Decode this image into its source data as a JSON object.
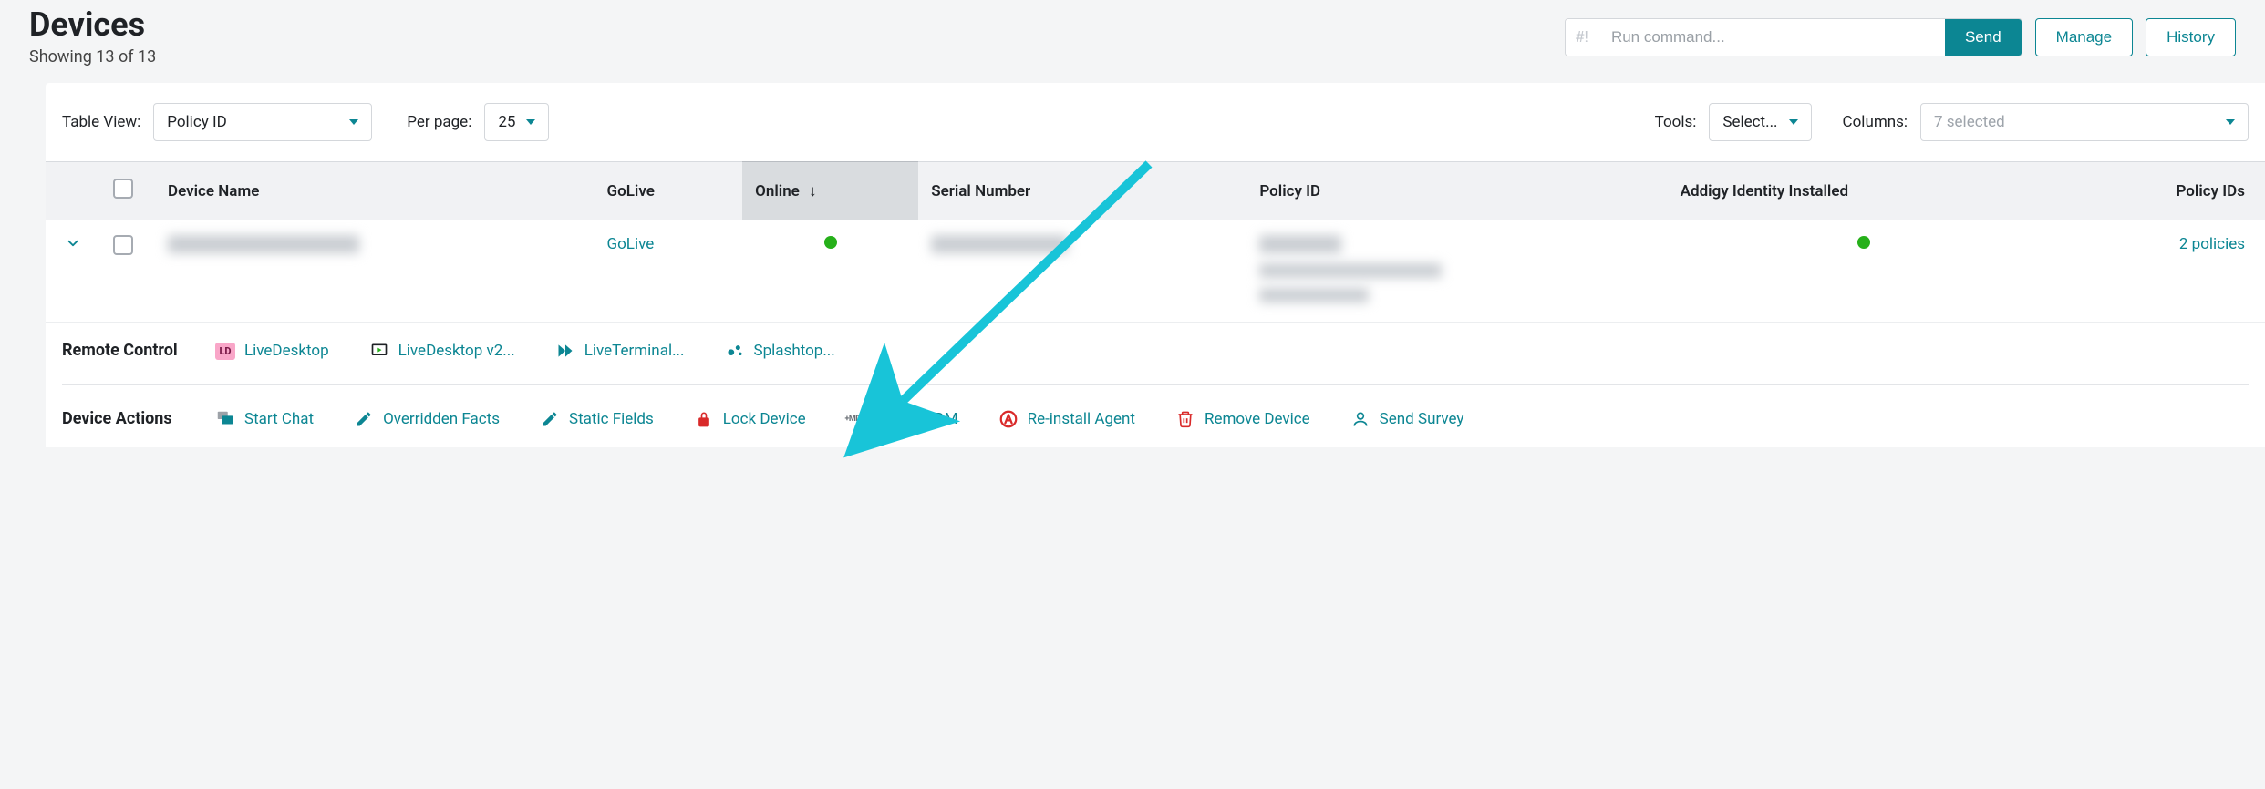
{
  "header": {
    "title": "Devices",
    "subtitle": "Showing 13 of 13",
    "command_prefix": "#!",
    "command_placeholder": "Run command...",
    "send_label": "Send",
    "manage_label": "Manage",
    "history_label": "History"
  },
  "toolbar": {
    "table_view_label": "Table View:",
    "table_view_value": "Policy ID",
    "per_page_label": "Per page:",
    "per_page_value": "25",
    "tools_label": "Tools:",
    "tools_value": "Select...",
    "columns_label": "Columns:",
    "columns_value": "7 selected"
  },
  "columns": {
    "device_name": "Device Name",
    "golive": "GoLive",
    "online": "Online",
    "serial": "Serial Number",
    "policy_id": "Policy ID",
    "addigy": "Addigy Identity Installed",
    "policy_ids": "Policy IDs"
  },
  "row": {
    "golive_link": "GoLive",
    "policies_link": "2 policies"
  },
  "remote_control": {
    "section_label": "Remote Control",
    "live_desktop": "LiveDesktop",
    "live_desktop_v2": "LiveDesktop v2...",
    "live_terminal": "LiveTerminal...",
    "splashtop": "Splashtop..."
  },
  "device_actions": {
    "section_label": "Device Actions",
    "start_chat": "Start Chat",
    "overridden_facts": "Overridden Facts",
    "static_fields": "Static Fields",
    "lock_device": "Lock Device",
    "install_mdm": "Install MDM",
    "reinstall_agent": "Re-install Agent",
    "remove_device": "Remove Device",
    "send_survey": "Send Survey"
  }
}
